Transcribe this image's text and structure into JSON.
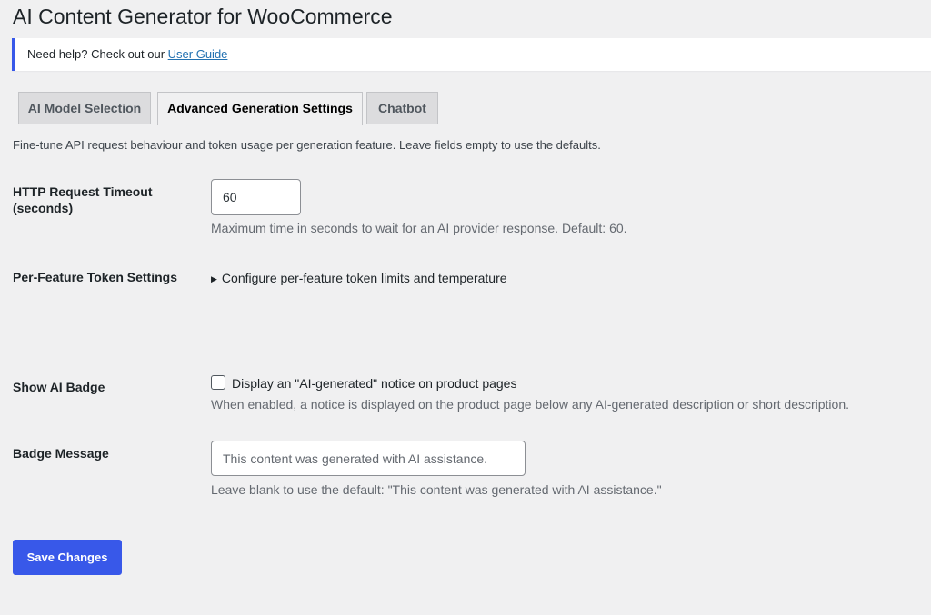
{
  "page": {
    "title": "AI Content Generator for WooCommerce"
  },
  "notice": {
    "prefix": "Need help? Check out our ",
    "link_text": "User Guide"
  },
  "tabs": [
    {
      "label": "AI Model Selection",
      "active": false
    },
    {
      "label": "Advanced Generation Settings",
      "active": true
    },
    {
      "label": "Chatbot",
      "active": false
    }
  ],
  "intro": "Fine-tune API request behaviour and token usage per generation feature. Leave fields empty to use the defaults.",
  "timeout": {
    "label_line1": "HTTP Request Timeout",
    "label_line2": "(seconds)",
    "value": "60",
    "description": "Maximum time in seconds to wait for an AI provider response. Default: 60."
  },
  "token_settings": {
    "label": "Per-Feature Token Settings",
    "summary": "Configure per-feature token limits and temperature"
  },
  "ai_badge": {
    "label": "Show AI Badge",
    "checkbox_label": "Display an \"AI-generated\" notice on product pages",
    "checked": false,
    "description": "When enabled, a notice is displayed on the product page below any AI-generated description or short description."
  },
  "badge_message": {
    "label": "Badge Message",
    "placeholder": "This content was generated with AI assistance.",
    "value": "",
    "description": "Leave blank to use the default: \"This content was generated with AI assistance.\""
  },
  "save_button": {
    "label": "Save Changes"
  },
  "colors": {
    "accent": "#3858e9",
    "background": "#f0f0f1",
    "link": "#2271b1"
  }
}
